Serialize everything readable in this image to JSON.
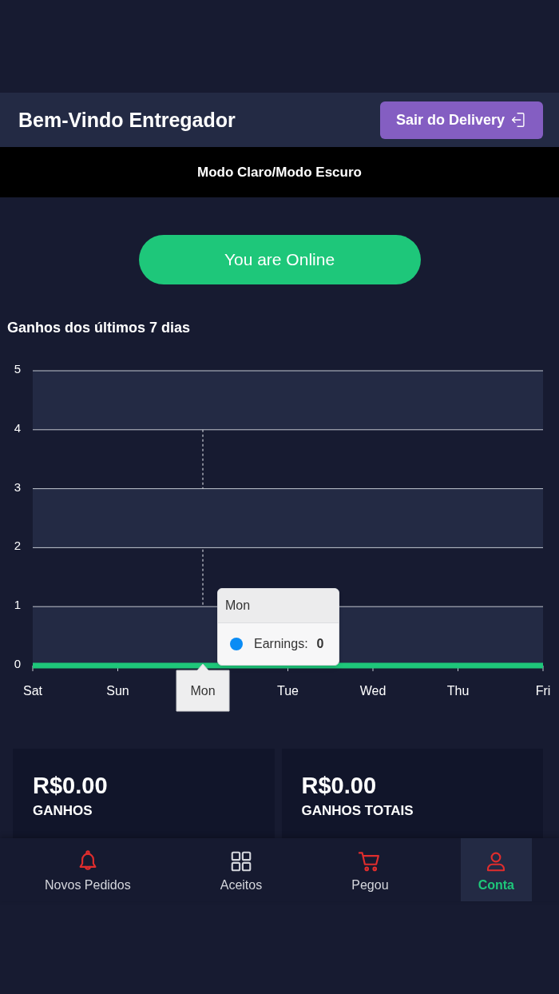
{
  "header": {
    "title": "Bem-Vindo Entregador",
    "exit_button": "Sair do Delivery"
  },
  "theme_toggle": {
    "label": "Modo Claro/Modo Escuro"
  },
  "status_button": {
    "label": "You are Online",
    "online": true
  },
  "earnings_chart": {
    "title": "Ganhos dos últimos 7 dias",
    "chart_data": {
      "type": "line",
      "categories": [
        "Sat",
        "Sun",
        "Mon",
        "Tue",
        "Wed",
        "Thu",
        "Fri"
      ],
      "series": [
        {
          "color": "#1ec77a",
          "values": [
            0,
            0,
            0,
            0,
            0,
            0,
            0
          ]
        }
      ],
      "ylim": [
        0,
        5
      ],
      "yticks": [
        0,
        1,
        2,
        3,
        4,
        5
      ],
      "grid": true
    },
    "hovered": [
      false,
      false,
      true,
      false,
      false,
      false,
      false
    ],
    "tooltip": {
      "title": "Mon",
      "label": "Earnings:",
      "value": "0"
    }
  },
  "stats": [
    {
      "value": "R$0.00",
      "label": "GANHOS"
    },
    {
      "value": "R$0.00",
      "label": "GANHOS TOTAIS"
    }
  ],
  "bottom_nav": [
    {
      "label": "Novos Pedidos",
      "color": "#e02d2d",
      "selected": false
    },
    {
      "label": "Aceitos",
      "color": "#d4d6dc",
      "selected": false
    },
    {
      "label": "Pegou",
      "color": "#e02d2d",
      "selected": false
    },
    {
      "label": "Conta",
      "color": "#e02d2d",
      "selected": true
    }
  ]
}
